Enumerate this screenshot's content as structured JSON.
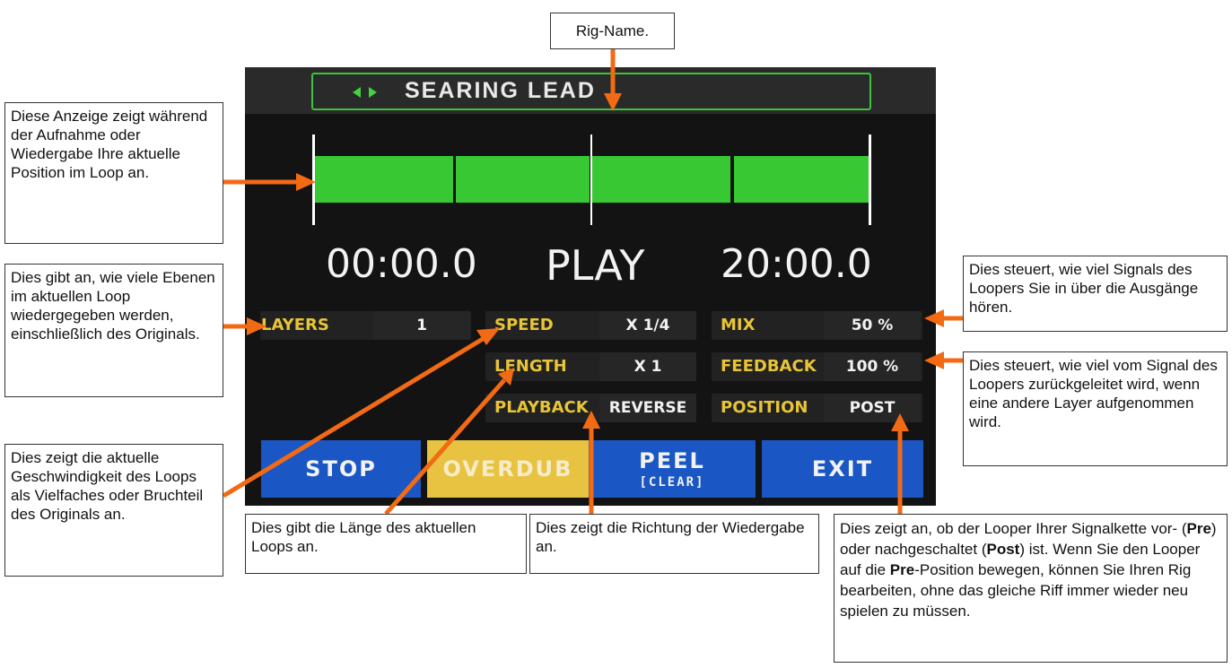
{
  "screen": {
    "rig_name": "SEARING LEAD",
    "progress_fraction": 1.0,
    "time_start": "00:00.0",
    "state": "PLAY",
    "time_end": "20:00.0",
    "params": {
      "layers": {
        "label": "LAYERS",
        "value": "1"
      },
      "speed": {
        "label": "SPEED",
        "value": "X 1/4"
      },
      "length": {
        "label": "LENGTH",
        "value": "X 1"
      },
      "playback": {
        "label": "PLAYBACK",
        "value": "REVERSE"
      },
      "mix": {
        "label": "MIX",
        "value": "50 %"
      },
      "feedback": {
        "label": "FEEDBACK",
        "value": "100 %"
      },
      "position": {
        "label": "POSITION",
        "value": "POST"
      }
    },
    "buttons": {
      "stop": "STOP",
      "overdub": "OVERDUB",
      "peel": "PEEL",
      "peel_sub": "[CLEAR]",
      "exit": "EXIT"
    }
  },
  "callouts": {
    "rig_name": "Rig-Name.",
    "progress": "Diese Anzeige zeigt während der Aufnahme oder Wiedergabe Ihre aktuelle Position im Loop an.",
    "layers": "Dies gibt an, wie viele Ebenen im aktuellen Loop wiedergegeben werden, einschließlich des Originals.",
    "speed": "Dies zeigt die aktuelle Geschwindigkeit des Loops als Vielfaches oder Bruchteil des Originals an.",
    "length": "Dies gibt die Länge des aktuellen Loops an.",
    "playback": "Dies zeigt die Richtung der Wiedergabe an.",
    "mix": "Dies steuert, wie viel Signals des Loopers Sie in über die Ausgänge hören.",
    "feedback": "Dies steuert, wie viel vom Signal des Loopers zurückgeleitet wird, wenn eine andere Layer aufgenommen wird.",
    "position": {
      "t1": "Dies zeigt an, ob der Looper Ihrer Signalkette vor- (",
      "b1": "Pre",
      "t2": ") oder nachgeschaltet (",
      "b2": "Post",
      "t3": ") ist. Wenn Sie den Looper auf die ",
      "b3": "Pre",
      "t4": "-Position bewegen, können Sie Ihren Rig bearbeiten, ohne das gleiche Riff immer wieder neu spielen zu müssen."
    }
  },
  "colors": {
    "arrow": "#f26a13",
    "progress_green": "#38c834",
    "label_yellow": "#e8c437",
    "button_blue": "#1a56c4",
    "button_yellow": "#e8c341"
  }
}
